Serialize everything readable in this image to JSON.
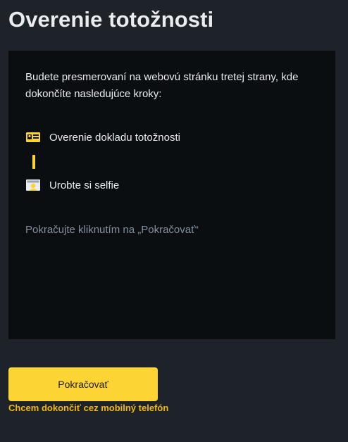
{
  "header": {
    "title": "Overenie totožnosti"
  },
  "card": {
    "intro": "Budete presmerovaní na webovú stránku tretej strany, kde dokončíte nasledujúce kroky:",
    "steps": [
      {
        "icon": "id-card-icon",
        "label": "Overenie dokladu totožnosti"
      },
      {
        "icon": "selfie-icon",
        "label": "Urobte si selfie"
      }
    ],
    "hint": "Pokračujte kliknutím na „Pokračovať“"
  },
  "actions": {
    "continue_label": "Pokračovať",
    "mobile_link_label": "Chcem dokončiť cez mobilný telefón"
  },
  "colors": {
    "background": "#1e2329",
    "card": "#0b0e11",
    "accent": "#fcd535",
    "link": "#f0b90b",
    "muted_text": "#848e9c"
  }
}
